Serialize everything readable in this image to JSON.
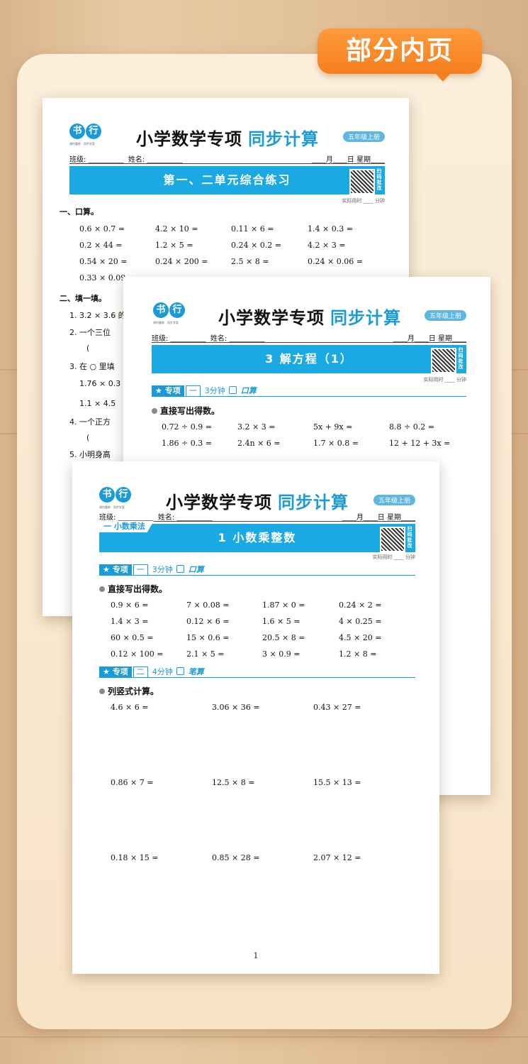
{
  "badge": "部分内页",
  "common": {
    "logo_char1": "书",
    "logo_char2": "行",
    "logo_sub": "课时重练 · 同步学案",
    "title_main": "小学数学专项",
    "title_accent": "同步计算",
    "grade": "五年级上册",
    "class_label": "班级: __________",
    "name_label": "姓名: __________",
    "date_label": "____月____日  星期____",
    "qr_text": "扫码批改",
    "time_label": "实际用时 ____ 分钟"
  },
  "page1": {
    "bar_title": "第一、二单元综合练习",
    "section1": "一、口算。",
    "rows": [
      [
        "0.6 × 0.7 =",
        "4.2 × 10 =",
        "0.11 × 6 =",
        "1.4 × 0.3 ="
      ],
      [
        "0.2 × 44 =",
        "1.2 × 5 =",
        "0.24 × 0.2 =",
        "4.2 × 3 ="
      ],
      [
        "0.54 × 20 =",
        "0.24 × 200 =",
        "2.5 × 8 =",
        "0.24 × 0.06 ="
      ],
      [
        "0.33 × 0.09 =",
        "",
        "",
        ""
      ]
    ],
    "section2": "二、填一填。",
    "fills": [
      "1. 3.2 × 3.6 的",
      "2. 一个三位",
      "(",
      "3. 在 ○ 里填",
      "1.76 × 0.3",
      "1.1 × 4.5",
      "4. 一个正方",
      "(",
      "5. 小明身高"
    ]
  },
  "page2": {
    "bar_title": "3  解方程（1）",
    "sec_star": "★ 专项",
    "sec_num": "一",
    "sec_min": "3分钟",
    "sec_mode": "口算",
    "heading": "直接写出得数。",
    "rows": [
      [
        "0.72 ÷ 0.9 =",
        "3.2 × 3 =",
        "5x + 9x =",
        "8.8 ÷ 0.2 ="
      ],
      [
        "1.86 ÷ 0.3 =",
        "2.4n × 6 =",
        "1.7 × 0.8 =",
        "12 + 12 + 3x ="
      ]
    ]
  },
  "page3": {
    "unit_tag": "一 小数乘法",
    "bar_title": "1  小数乘整数",
    "sec1": {
      "star": "★ 专项",
      "num": "一",
      "min": "3分钟",
      "mode": "口算"
    },
    "heading1": "直接写出得数。",
    "rows1": [
      [
        "0.9 × 6 =",
        "7 × 0.08 =",
        "1.87 × 0 =",
        "0.24 × 2 ="
      ],
      [
        "1.4 × 3 =",
        "0.12 × 6 =",
        "1.6 × 5 =",
        "4 × 0.25 ="
      ],
      [
        "60 × 0.5 =",
        "15 × 0.6 =",
        "20.5 × 8 =",
        "4.5 × 20 ="
      ],
      [
        "0.12 × 100 =",
        "2.1 × 5 =",
        "3 × 0.9 =",
        "1.2 × 8 ="
      ]
    ],
    "sec2": {
      "star": "★ 专项",
      "num": "二",
      "min": "4分钟",
      "mode": "笔算"
    },
    "heading2": "列竖式计算。",
    "rows2": [
      [
        "4.6 × 6 =",
        "3.06 × 36 =",
        "0.43 × 27 ="
      ],
      [
        "0.86 × 7 =",
        "12.5 × 8 =",
        "15.5 × 13 ="
      ],
      [
        "0.18 × 15 =",
        "0.85 × 28 =",
        "2.07 × 12 ="
      ]
    ],
    "page_number": "1"
  }
}
